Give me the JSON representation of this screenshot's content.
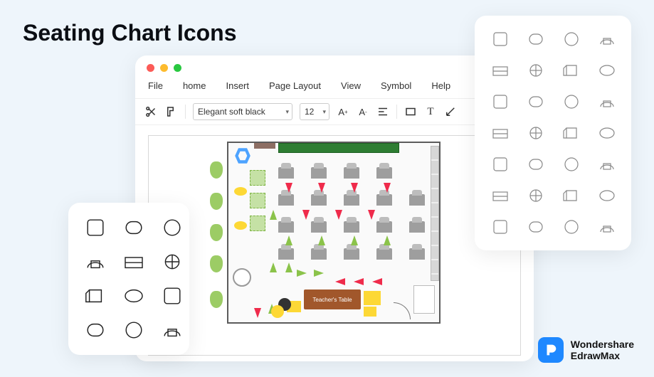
{
  "page_title": "Seating Chart Icons",
  "window": {
    "traffic_colors": {
      "close": "#fc5b57",
      "min": "#fdbb2e",
      "max": "#29c840"
    },
    "menu": [
      "File",
      "home",
      "Insert",
      "Page Layout",
      "View",
      "Symbol",
      "Help"
    ],
    "toolbar": {
      "font_select": "Elegant soft black",
      "size_select": "12"
    }
  },
  "floorplan": {
    "teacher_label": "Teacher's Table"
  },
  "right_panel_icons": [
    "dice-icon",
    "chair-square-icon",
    "chair-round-top-icon",
    "chair-open-icon",
    "armchair-icon",
    "armchair-2-icon",
    "pot-icon",
    "box-icon",
    "arch-icon",
    "screen-icon",
    "panel-icon",
    "frame-icon",
    "lamp-icon",
    "triangle-hang-icon",
    "pendants-icon",
    "dual-pendant-icon",
    "round-table-icon",
    "wheel-icon",
    "fan-icon",
    "knob-icon",
    "bench-icon",
    "rect-icon",
    "rounded-icon",
    "square-icon",
    "cup-icon",
    "paper-icon",
    "group-icon",
    "flower-icon"
  ],
  "left_panel_icons": [
    "sofa-icon",
    "armchair-top-icon",
    "circle-seat-icon",
    "loveseat-icon",
    "chair-back-icon",
    "spiral-seat-icon",
    "arc-sofa-icon",
    "small-seat-icon",
    "l-sofa-icon",
    "table-icon",
    "double-table-icon",
    "side-table-icon"
  ],
  "brand": {
    "line1": "Wondershare",
    "line2": "EdrawMax"
  }
}
